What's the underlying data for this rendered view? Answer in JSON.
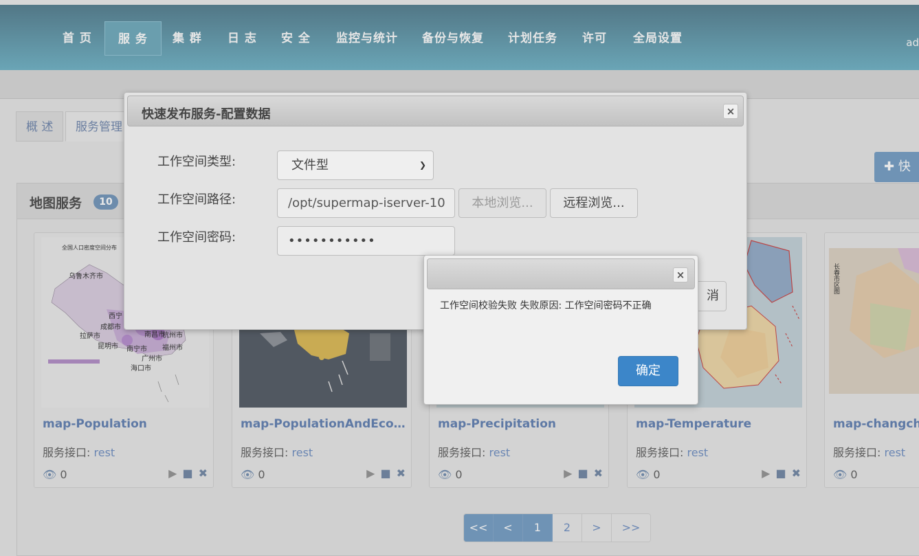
{
  "nav": {
    "items": [
      "首 页",
      "服 务",
      "集 群",
      "日 志",
      "安 全",
      "监控与统计",
      "备份与恢复",
      "计划任务",
      "许可",
      "全局设置"
    ],
    "active_index": 1,
    "user_text": "ad"
  },
  "tabs": [
    "概 述",
    "服务管理"
  ],
  "quick_publish_label": "快",
  "panel": {
    "title": "地图服务",
    "count": "10"
  },
  "cards": [
    {
      "name": "map-Population",
      "iface_label": "服务接口:",
      "iface": "rest",
      "views": "0",
      "thumb_title": "全国人口密度空间分布"
    },
    {
      "name": "map-PopulationAndEcono...",
      "iface_label": "服务接口:",
      "iface": "rest",
      "views": "0"
    },
    {
      "name": "map-Precipitation",
      "iface_label": "服务接口:",
      "iface": "rest",
      "views": "0"
    },
    {
      "name": "map-Temperature",
      "iface_label": "服务接口:",
      "iface": "rest",
      "views": "0"
    },
    {
      "name": "map-changchu",
      "iface_label": "服务接口:",
      "iface": "rest",
      "views": "0"
    }
  ],
  "thumb_labels": {
    "pop": [
      "乌鲁木齐市",
      "西宁",
      "成都市",
      "拉萨市",
      "昆明市",
      "南宁市",
      "南昌市",
      "福州市",
      "广州市",
      "海口市",
      "杭州市"
    ],
    "changchun": "长春市区图"
  },
  "pager": [
    "<<",
    "<",
    "1",
    "2",
    ">",
    ">>"
  ],
  "dialog": {
    "title": "快速发布服务-配置数据",
    "type_label": "工作空间类型:",
    "type_value": "文件型",
    "path_label": "工作空间路径:",
    "path_value": "/opt/supermap-iserver-10",
    "password_label": "工作空间密码:",
    "password_value": "•••••••••••",
    "local_browse": "本地浏览...",
    "remote_browse": "远程浏览...",
    "cancel_peek": "消"
  },
  "alert": {
    "message": "工作空间校验失败 失败原因: 工作空间密码不正确",
    "ok": "确定"
  }
}
